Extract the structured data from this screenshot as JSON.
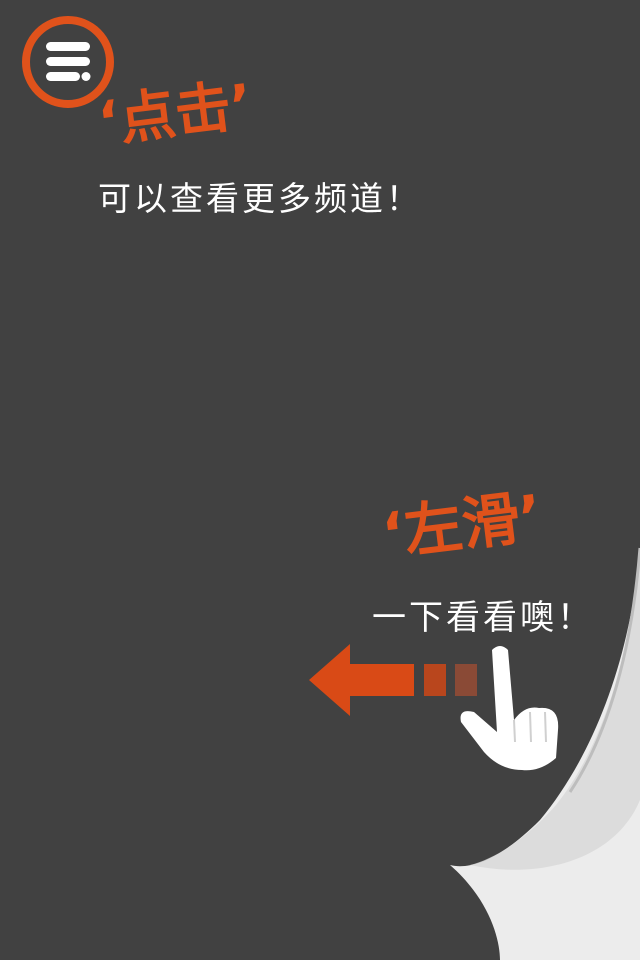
{
  "menu": {
    "icon": "menu-icon",
    "accent_color": "#e0521b"
  },
  "hints": {
    "tap": {
      "title": "‘点击’",
      "text": "可以查看更多频道！"
    },
    "swipe": {
      "title": "‘左滑’",
      "text": "一下看看噢！"
    }
  },
  "icons": {
    "arrow": "left-arrow-icon",
    "hand": "pointing-hand-icon",
    "curl": "page-curl-icon"
  },
  "colors": {
    "background": "#414141",
    "accent": "#e0521b",
    "text": "#ffffff"
  }
}
